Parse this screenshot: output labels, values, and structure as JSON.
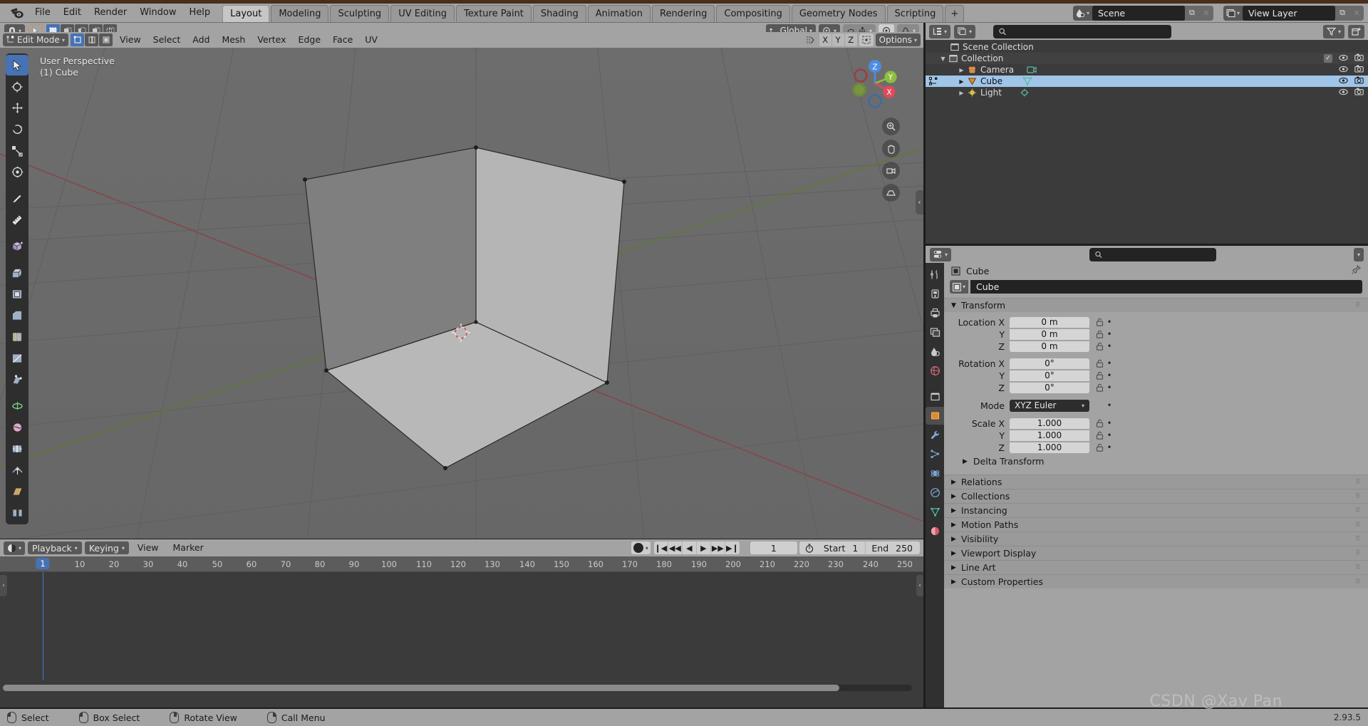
{
  "topbar": {
    "logo_icon": "blender-logo-icon",
    "menus": [
      "File",
      "Edit",
      "Render",
      "Window",
      "Help"
    ],
    "workspace_tabs": [
      {
        "label": "Layout",
        "active": true
      },
      {
        "label": "Modeling",
        "active": false
      },
      {
        "label": "Sculpting",
        "active": false
      },
      {
        "label": "UV Editing",
        "active": false
      },
      {
        "label": "Texture Paint",
        "active": false
      },
      {
        "label": "Shading",
        "active": false
      },
      {
        "label": "Animation",
        "active": false
      },
      {
        "label": "Rendering",
        "active": false
      },
      {
        "label": "Compositing",
        "active": false
      },
      {
        "label": "Geometry Nodes",
        "active": false
      },
      {
        "label": "Scripting",
        "active": false
      }
    ],
    "add_workspace_label": "+",
    "scene": {
      "icon": "scene-icon",
      "name": "Scene",
      "new_icon": "duplicate-icon",
      "unlink_icon": "x-icon"
    },
    "view_layer": {
      "icon": "view-layer-icon",
      "name": "View Layer",
      "new_icon": "duplicate-icon",
      "unlink_icon": "x-icon"
    }
  },
  "tool_settings": {
    "snap_magnet_icon": "magnet-icon",
    "cursor_icon": "tweak-cursor-icon",
    "select_modes": [
      "select-set-icon",
      "select-extend-icon",
      "select-subtract-icon",
      "select-invert-icon",
      "select-intersect-icon"
    ],
    "transform_orientation": {
      "label": "Global",
      "icon": "orientation-icon"
    },
    "pivot_icon": "pivot-point-icon",
    "snap_icon": "snap-icon",
    "snap_mode_icon": "snap-increment-icon",
    "proportional_icon": "proportional-editing-icon",
    "falloff_icon": "smooth-falloff-icon"
  },
  "viewport_header": {
    "mode": {
      "label": "Edit Mode",
      "icon": "edit-mode-icon"
    },
    "mesh_select_modes": [
      {
        "name": "vertex-select-icon",
        "active": true
      },
      {
        "name": "edge-select-icon",
        "active": false
      },
      {
        "name": "face-select-icon",
        "active": false
      }
    ],
    "menus": [
      "View",
      "Select",
      "Add",
      "Mesh",
      "Vertex",
      "Edge",
      "Face",
      "UV"
    ],
    "right_tools": {
      "mesh_edit_mode_icon": "mesh-edit-overlay-icon",
      "axis_toggles": [
        "X",
        "Y",
        "Z"
      ],
      "mirror_icon": "mirror-icon",
      "options_label": "Options"
    },
    "overlay_row": {
      "visibility_icon": "object-types-visibility-icon",
      "gizmo_icon": "gizmo-icon",
      "overlays_icon": "overlays-icon",
      "xray_icon": "xray-toggle-icon",
      "shading_modes": [
        "wireframe-shading-icon",
        "solid-shading-icon",
        "material-preview-icon",
        "rendered-shading-icon"
      ],
      "active_shading": "solid-shading-icon"
    }
  },
  "viewport": {
    "perspective_label": "User Perspective",
    "object_label": "(1) Cube",
    "gizmo_axes": [
      {
        "label": "Z",
        "color": "#4c8de0"
      },
      {
        "label": "Y",
        "color": "#8cbf3f"
      },
      {
        "label": "X",
        "color": "#e04a5a"
      }
    ],
    "nav_buttons": [
      "zoom-icon",
      "pan-hand-icon",
      "camera-view-icon",
      "toggle-perspective-icon"
    ],
    "toolbar": [
      {
        "name": "tweak-tool",
        "icon": "cursor-arrow-icon",
        "active": true
      },
      {
        "name": "cursor-tool",
        "icon": "3d-cursor-icon",
        "active": false
      },
      {
        "name": "move-tool",
        "icon": "move-arrows-icon",
        "active": false
      },
      {
        "name": "rotate-tool",
        "icon": "rotate-icon",
        "active": false
      },
      {
        "name": "scale-tool",
        "icon": "scale-icon",
        "active": false
      },
      {
        "name": "transform-tool",
        "icon": "transform-icon",
        "active": false
      },
      {
        "name": "annotate-tool",
        "icon": "pencil-icon",
        "active": false
      },
      {
        "name": "measure-tool",
        "icon": "ruler-icon",
        "active": false
      },
      {
        "name": "add-cube-tool",
        "icon": "add-cube-icon",
        "active": false
      },
      {
        "name": "extrude-region-tool",
        "icon": "extrude-icon",
        "active": false
      },
      {
        "name": "inset-faces-tool",
        "icon": "inset-faces-icon",
        "active": false
      },
      {
        "name": "bevel-tool",
        "icon": "bevel-icon",
        "active": false
      },
      {
        "name": "loop-cut-tool",
        "icon": "loop-cut-icon",
        "active": false
      },
      {
        "name": "knife-tool",
        "icon": "knife-icon",
        "active": false
      },
      {
        "name": "poly-build-tool",
        "icon": "poly-build-icon",
        "active": false
      },
      {
        "name": "spin-tool",
        "icon": "spin-icon",
        "active": false
      },
      {
        "name": "smooth-tool",
        "icon": "smooth-icon",
        "active": false
      },
      {
        "name": "edge-slide-tool",
        "icon": "edge-slide-icon",
        "active": false
      },
      {
        "name": "shrink-fatten-tool",
        "icon": "shrink-fatten-icon",
        "active": false
      },
      {
        "name": "shear-tool",
        "icon": "shear-icon",
        "active": false
      },
      {
        "name": "rip-region-tool",
        "icon": "rip-region-icon",
        "active": false
      }
    ]
  },
  "outliner": {
    "display_mode_icon": "outliner-display-mode-icon",
    "filter_id_icon": "id-type-filter-icon",
    "search_placeholder": "",
    "search_value": "",
    "filter_icon": "funnel-filter-icon",
    "new_collection_icon": "new-collection-icon",
    "rows": [
      {
        "label": "Scene Collection",
        "icon": "scene-collection-icon",
        "depth": 0,
        "disclosure": "",
        "selected": false,
        "checkbox": false,
        "eye": false,
        "camera": false
      },
      {
        "label": "Collection",
        "icon": "collection-icon",
        "depth": 1,
        "disclosure": "▼",
        "selected": false,
        "checkbox": true,
        "eye": true,
        "camera": true
      },
      {
        "label": "Camera",
        "icon": "camera-object-icon",
        "depth": 2,
        "disclosure": "▶",
        "selected": false,
        "checkbox": false,
        "eye": true,
        "camera": true,
        "data_icon": "camera-data-icon"
      },
      {
        "label": "Cube",
        "icon": "mesh-object-icon",
        "depth": 2,
        "disclosure": "▶",
        "selected": true,
        "checkbox": false,
        "eye": true,
        "camera": true,
        "data_icon": "mesh-data-icon"
      },
      {
        "label": "Light",
        "icon": "light-object-icon",
        "depth": 2,
        "disclosure": "▶",
        "selected": false,
        "checkbox": false,
        "eye": true,
        "camera": true,
        "data_icon": "light-data-icon"
      }
    ]
  },
  "properties": {
    "editor_icon": "properties-editor-icon",
    "search_placeholder": "",
    "search_value": "",
    "breadcrumb": {
      "icon": "object-properties-icon",
      "label": "Cube"
    },
    "object_name": "Cube",
    "object_name_icon": "object-icon",
    "pin_icon": "pin-icon",
    "tabs": [
      {
        "name": "tool-properties-tab",
        "icon": "tool-icon",
        "active": false
      },
      {
        "name": "render-properties-tab",
        "icon": "render-camera-icon",
        "active": false
      },
      {
        "name": "output-properties-tab",
        "icon": "printer-icon",
        "active": false
      },
      {
        "name": "view-layer-properties-tab",
        "icon": "images-icon",
        "active": false
      },
      {
        "name": "scene-properties-tab",
        "icon": "scene-cone-icon",
        "active": false
      },
      {
        "name": "world-properties-tab",
        "icon": "world-globe-icon",
        "active": false
      },
      {
        "name": "collection-properties-tab",
        "icon": "collection-box-icon",
        "active": false
      },
      {
        "name": "object-properties-tab",
        "icon": "orange-square-icon",
        "active": true
      },
      {
        "name": "modifier-properties-tab",
        "icon": "wrench-icon",
        "active": false
      },
      {
        "name": "particle-properties-tab",
        "icon": "particles-icon",
        "active": false
      },
      {
        "name": "physics-properties-tab",
        "icon": "physics-orbit-icon",
        "active": false
      },
      {
        "name": "constraint-properties-tab",
        "icon": "constraint-icon",
        "active": false
      },
      {
        "name": "data-properties-tab",
        "icon": "mesh-data-green-icon",
        "active": false
      },
      {
        "name": "material-properties-tab",
        "icon": "material-sphere-icon",
        "active": false
      }
    ],
    "transform_panel": {
      "title": "Transform",
      "open": true,
      "groups": [
        {
          "fields": [
            {
              "label": "Location X",
              "value": "0 m"
            },
            {
              "label": "Y",
              "value": "0 m"
            },
            {
              "label": "Z",
              "value": "0 m"
            }
          ]
        },
        {
          "fields": [
            {
              "label": "Rotation X",
              "value": "0°"
            },
            {
              "label": "Y",
              "value": "0°"
            },
            {
              "label": "Z",
              "value": "0°"
            }
          ]
        }
      ],
      "mode": {
        "label": "Mode",
        "value": "XYZ Euler"
      },
      "scale": {
        "fields": [
          {
            "label": "Scale X",
            "value": "1.000"
          },
          {
            "label": "Y",
            "value": "1.000"
          },
          {
            "label": "Z",
            "value": "1.000"
          }
        ]
      },
      "delta_transform": "Delta Transform"
    },
    "closed_panels": [
      "Relations",
      "Collections",
      "Instancing",
      "Motion Paths",
      "Visibility",
      "Viewport Display",
      "Line Art",
      "Custom Properties"
    ]
  },
  "timeline": {
    "editor_icon": "timeline-editor-icon",
    "dropdowns": [
      {
        "label": "Playback"
      },
      {
        "label": "Keying"
      }
    ],
    "menus": [
      "View",
      "Marker"
    ],
    "record_icon": "record-keyframe-icon",
    "transport": [
      "jump-to-start-icon",
      "jump-to-keyframe-prev-icon",
      "play-reverse-icon",
      "play-icon",
      "jump-to-keyframe-next-icon",
      "jump-to-end-icon"
    ],
    "current_frame": "1",
    "frame_icon": "stopwatch-icon",
    "start_label": "Start",
    "start_value": "1",
    "end_label": "End",
    "end_value": "250",
    "ruler_ticks": [
      "10",
      "20",
      "30",
      "40",
      "50",
      "60",
      "70",
      "80",
      "90",
      "100",
      "110",
      "120",
      "130",
      "140",
      "150",
      "160",
      "170",
      "180",
      "190",
      "200",
      "210",
      "220",
      "230",
      "240",
      "250"
    ],
    "playhead_label": "1"
  },
  "statusbar": {
    "items": [
      {
        "icon": "mouse-left-icon",
        "label": "Select"
      },
      {
        "icon": "mouse-left-drag-icon",
        "label": "Box Select"
      },
      {
        "icon": "mouse-middle-icon",
        "label": "Rotate View"
      },
      {
        "icon": "mouse-right-icon",
        "label": "Call Menu"
      }
    ],
    "watermark": "CSDN @Xav Pan",
    "version": "2.93.5"
  },
  "colors": {
    "accent_blue": "#4772b3",
    "header_grey": "#a3a3a3",
    "viewport_bg": "#6a6a6a",
    "panel_bg": "#3b3b3b",
    "axis_x": "#e04a5a",
    "axis_y": "#8cbf3f",
    "axis_z": "#4c8de0",
    "selected_row": "#9fc5e8"
  }
}
